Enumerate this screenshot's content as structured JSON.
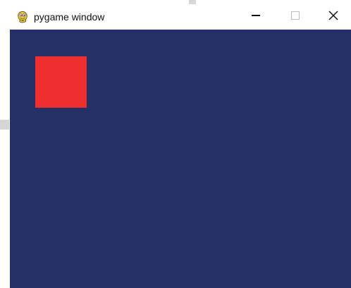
{
  "window": {
    "title": "pygame window",
    "app_icon": "pygame-snake-icon",
    "controls": {
      "minimize_icon": "minimize-icon",
      "maximize_icon": "maximize-icon",
      "close_icon": "close-icon"
    }
  },
  "game": {
    "background_color": "#243066",
    "player": {
      "shape": "square",
      "color": "#ef2f2d"
    }
  }
}
